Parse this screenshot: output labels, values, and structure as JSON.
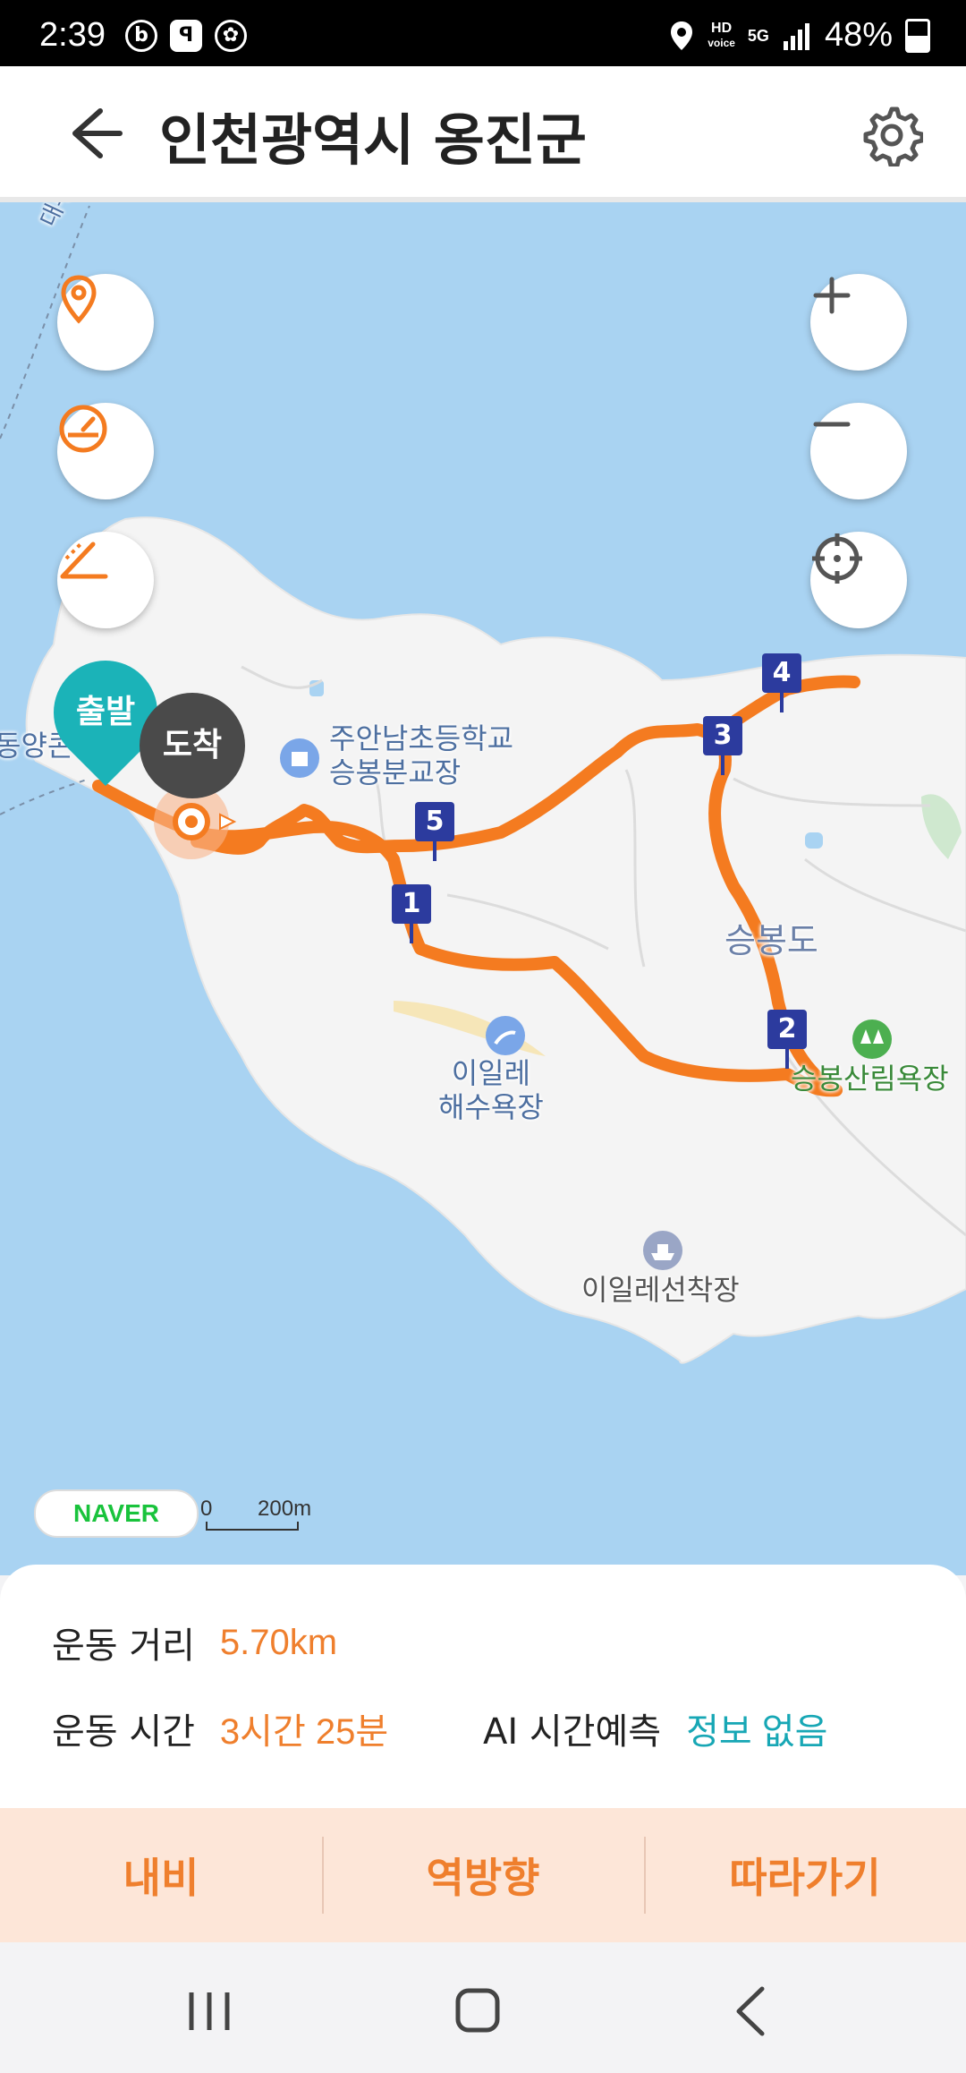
{
  "status": {
    "time": "2:39",
    "battery": "48%",
    "hd_label": "HD",
    "voice_label": "voice",
    "net_label": "5G"
  },
  "header": {
    "title": "인천광역시 옹진군"
  },
  "map": {
    "labels": {
      "school_line1": "주안남초등학교",
      "school_line2": "승봉분교장",
      "island": "승봉도",
      "beach_line1": "이일레",
      "beach_line2": "해수욕장",
      "dock": "이일레선착장",
      "forest": "승봉산림욕장",
      "left_edge": "동양콘",
      "channel": "대부도-"
    },
    "start_label": "출발",
    "end_label": "도착",
    "waypoints": [
      "1",
      "2",
      "3",
      "4",
      "5"
    ],
    "route_color": "#f47b20",
    "provider": "NAVER",
    "scale_zero": "0",
    "scale_distance": "200m"
  },
  "info": {
    "distance_label": "운동 거리",
    "distance_value": "5.70km",
    "time_label": "운동 시간",
    "time_value": "3시간 25분",
    "ai_label": "AI 시간예측",
    "ai_value": "정보 없음"
  },
  "actions": {
    "navi": "내비",
    "reverse": "역방향",
    "follow": "따라가기"
  }
}
